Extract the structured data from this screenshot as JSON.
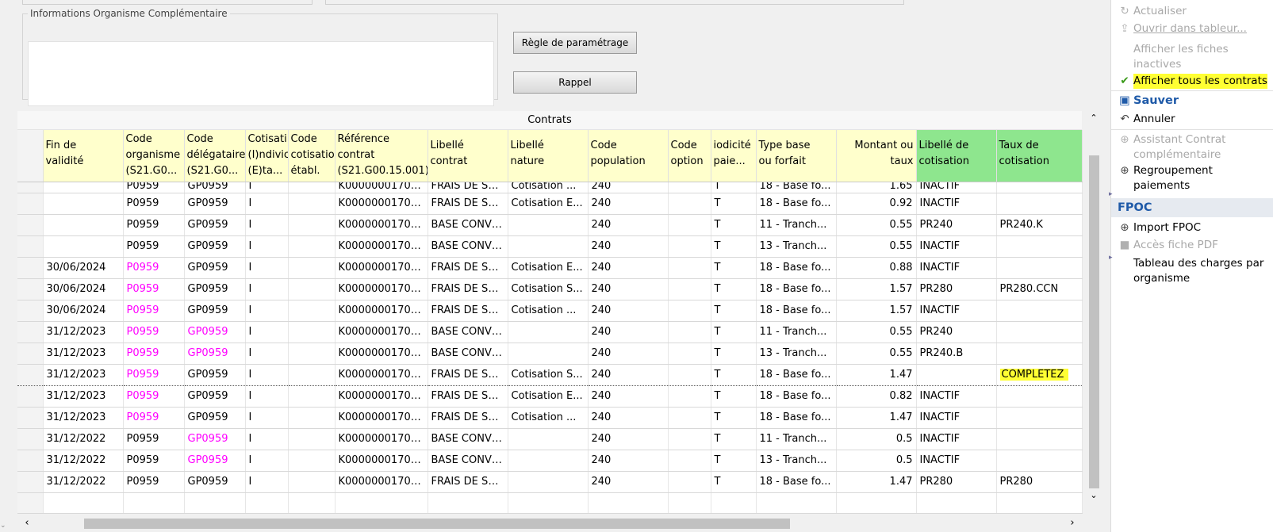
{
  "info_section": {
    "legend": "Informations Organisme Complémentaire",
    "text_value": ""
  },
  "buttons": {
    "regle": "Règle de paramétrage",
    "rappel": "Rappel"
  },
  "grid": {
    "title": "Contrats",
    "columns": [
      {
        "l1": "Fin de",
        "l2": "validité",
        "l3": ""
      },
      {
        "l1": "Code",
        "l2": "organisme",
        "l3": "(S21.G0..."
      },
      {
        "l1": "Code",
        "l2": "délégataire",
        "l3": "(S21.G0..."
      },
      {
        "l1": "Cotisati",
        "l2": "(I)ndivic",
        "l3": "(E)ta..."
      },
      {
        "l1": "Code",
        "l2": "cotisatio",
        "l3": "établ."
      },
      {
        "l1": "Référence",
        "l2": "contrat",
        "l3": "(S21.G00.15.001)"
      },
      {
        "l1": "Libellé",
        "l2": "contrat",
        "l3": ""
      },
      {
        "l1": "Libellé",
        "l2": "nature",
        "l3": ""
      },
      {
        "l1": "Code",
        "l2": "population",
        "l3": ""
      },
      {
        "l1": "Code",
        "l2": "option",
        "l3": ""
      },
      {
        "l1": "iodicité",
        "l2": "paie...",
        "l3": ""
      },
      {
        "l1": "Type base",
        "l2": "ou forfait",
        "l3": ""
      },
      {
        "l1": "Montant ou",
        "l2": "taux",
        "l3": ""
      },
      {
        "l1": "Libellé de",
        "l2": "cotisation",
        "l3": ""
      },
      {
        "l1": "Taux de",
        "l2": "cotisation",
        "l3": ""
      }
    ],
    "rows": [
      [
        "",
        "P0959",
        "GP0959",
        "I",
        "",
        "K00000001700...",
        "FRAIS DE SA...",
        "Cotisation ...",
        "240",
        "",
        "T",
        "18 - Base fo...",
        "1.65",
        "INACTIF",
        ""
      ],
      [
        "",
        "P0959",
        "GP0959",
        "I",
        "",
        "K00000001700...",
        "FRAIS DE SA...",
        "Cotisation E...",
        "240",
        "",
        "T",
        "18 - Base fo...",
        "0.92",
        "INACTIF",
        ""
      ],
      [
        "",
        "P0959",
        "GP0959",
        "I",
        "",
        "K00000001700...",
        "BASE CONVE...",
        "",
        "240",
        "",
        "T",
        "11 - Tranch...",
        "0.55",
        "PR240",
        "PR240.K"
      ],
      [
        "",
        "P0959",
        "GP0959",
        "I",
        "",
        "K00000001700...",
        "BASE CONVE...",
        "",
        "240",
        "",
        "T",
        "13 - Tranch...",
        "0.55",
        "INACTIF",
        ""
      ],
      [
        "30/06/2024",
        "P0959",
        "GP0959",
        "I",
        "",
        "K00000001700...",
        "FRAIS DE SA...",
        "Cotisation E...",
        "240",
        "",
        "T",
        "18 - Base fo...",
        "0.88",
        "INACTIF",
        ""
      ],
      [
        "30/06/2024",
        "P0959",
        "GP0959",
        "I",
        "",
        "K00000001700...",
        "FRAIS DE SA...",
        "Cotisation S...",
        "240",
        "",
        "T",
        "18 - Base fo...",
        "1.57",
        "PR280",
        "PR280.CCN"
      ],
      [
        "30/06/2024",
        "P0959",
        "GP0959",
        "I",
        "",
        "K00000001700...",
        "FRAIS DE SA...",
        "Cotisation ...",
        "240",
        "",
        "T",
        "18 - Base fo...",
        "1.57",
        "INACTIF",
        ""
      ],
      [
        "31/12/2023",
        "P0959",
        "GP0959",
        "I",
        "",
        "K00000001700...",
        "BASE CONVE...",
        "",
        "240",
        "",
        "T",
        "11 - Tranch...",
        "0.55",
        "PR240",
        ""
      ],
      [
        "31/12/2023",
        "P0959",
        "GP0959",
        "I",
        "",
        "K00000001700...",
        "BASE CONVE...",
        "",
        "240",
        "",
        "T",
        "13 - Tranch...",
        "0.55",
        "PR240.B",
        ""
      ],
      [
        "31/12/2023",
        "P0959",
        "GP0959",
        "I",
        "",
        "K00000001700...",
        "FRAIS DE SA...",
        "Cotisation S...",
        "240",
        "",
        "T",
        "18 - Base fo...",
        "1.47",
        "",
        "COMPLETEZ"
      ],
      [
        "31/12/2023",
        "P0959",
        "GP0959",
        "I",
        "",
        "K00000001700...",
        "FRAIS DE SA...",
        "Cotisation E...",
        "240",
        "",
        "T",
        "18 - Base fo...",
        "0.82",
        "INACTIF",
        ""
      ],
      [
        "31/12/2023",
        "P0959",
        "GP0959",
        "I",
        "",
        "K00000001700...",
        "FRAIS DE SA...",
        "Cotisation ...",
        "240",
        "",
        "T",
        "18 - Base fo...",
        "1.47",
        "INACTIF",
        ""
      ],
      [
        "31/12/2022",
        "P0959",
        "GP0959",
        "I",
        "",
        "K00000001700...",
        "BASE CONVE...",
        "",
        "240",
        "",
        "T",
        "11 - Tranch...",
        "0.5",
        "INACTIF",
        ""
      ],
      [
        "31/12/2022",
        "P0959",
        "GP0959",
        "I",
        "",
        "K00000001700...",
        "BASE CONVE...",
        "",
        "240",
        "",
        "T",
        "13 - Tranch...",
        "0.5",
        "INACTIF",
        ""
      ],
      [
        "31/12/2022",
        "P0959",
        "GP0959",
        "I",
        "",
        "K00000001700...",
        "FRAIS DE SA...",
        "",
        "240",
        "",
        "T",
        "18 - Base fo...",
        "1.47",
        "PR280",
        "PR280"
      ]
    ],
    "pink_org_rows": [
      4,
      5,
      6,
      7,
      8,
      9,
      10,
      11
    ],
    "pink_del_rows": [
      7,
      8,
      12,
      13
    ],
    "selected_row": 9
  },
  "sidebar": {
    "actualiser": "Actualiser",
    "ouvrir": "Ouvrir dans tableur...",
    "afficher_inactives": "Afficher les fiches inactives",
    "afficher_contrats": "Afficher tous les contrats",
    "sauver": "Sauver",
    "annuler": "Annuler",
    "assistant": "Assistant Contrat complémentaire",
    "regroupement": "Regroupement paiements",
    "section_fpoc": "FPOC",
    "import_fpoc": "Import FPOC",
    "acces_pdf": "Accès fiche PDF",
    "tableau_charges": "Tableau des charges par organisme"
  },
  "colors": {
    "header_yellow": "#ffffcc",
    "header_green": "#8ee68e",
    "pink": "#ff00ff",
    "highlight": "#ffff33",
    "accent_blue": "#1f5aa8"
  }
}
